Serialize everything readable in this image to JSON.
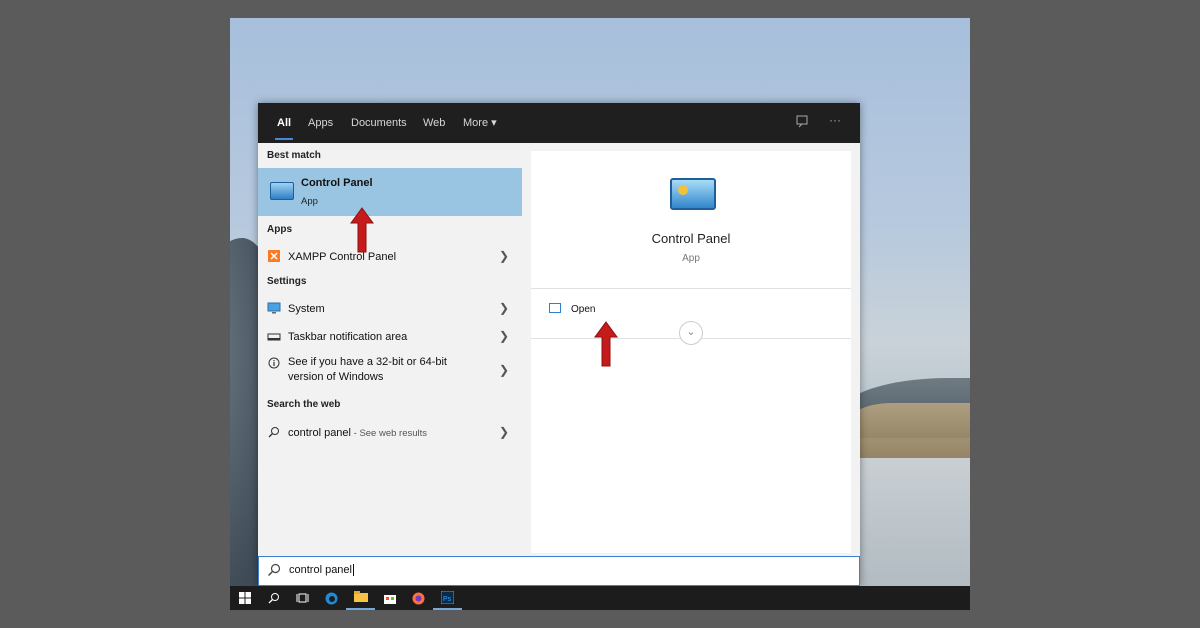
{
  "tabs": [
    "All",
    "Apps",
    "Documents",
    "Web",
    "More ▾"
  ],
  "topbar_icons": [
    "feedback-icon",
    "ellipsis-icon"
  ],
  "left": {
    "best_match_header": "Best match",
    "best": {
      "title": "Control Panel",
      "subtitle": "App"
    },
    "apps_header": "Apps",
    "apps": [
      {
        "label": "XAMPP Control Panel",
        "icon": "xampp-icon"
      }
    ],
    "settings_header": "Settings",
    "settings": [
      {
        "label": "System",
        "icon": "system-monitor-icon"
      },
      {
        "label": "Taskbar notification area",
        "icon": "taskbar-icon"
      },
      {
        "label_line1": "See if you have a 32-bit or 64-bit",
        "label_line2": "version of Windows",
        "icon": "info-icon"
      }
    ],
    "web_header": "Search the web",
    "web": {
      "label": "control panel",
      "suffix": " - See web results"
    }
  },
  "right": {
    "title": "Control Panel",
    "subtitle": "App",
    "open_label": "Open"
  },
  "search": {
    "value": "control panel"
  },
  "colors": {
    "selected_bg": "#99c5e3",
    "arrow": "#c51b1b",
    "accent": "#3c7fd1"
  },
  "taskbar": [
    "windows-start-icon",
    "search-icon",
    "task-view-icon",
    "edge-icon",
    "file-explorer-icon",
    "store-icon",
    "firefox-icon",
    "photoshop-icon"
  ]
}
